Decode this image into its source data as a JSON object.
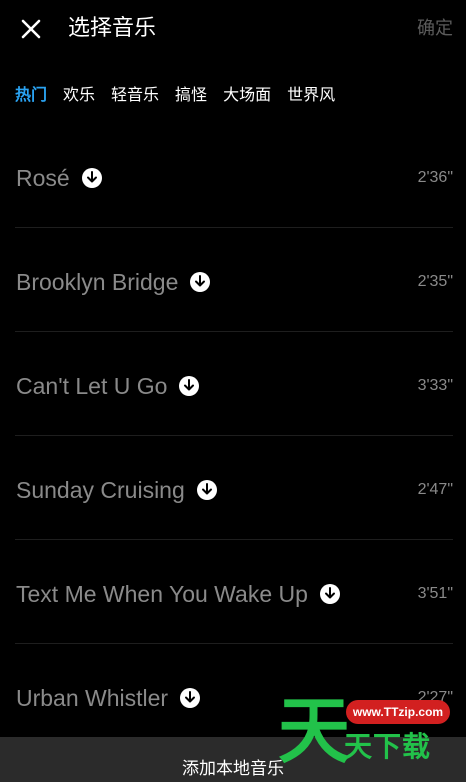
{
  "header": {
    "close_icon": "close-icon",
    "title": "选择音乐",
    "confirm_label": "确定"
  },
  "tabs": [
    {
      "label": "热门",
      "active": true
    },
    {
      "label": "欢乐",
      "active": false
    },
    {
      "label": "轻音乐",
      "active": false
    },
    {
      "label": "搞怪",
      "active": false
    },
    {
      "label": "大场面",
      "active": false
    },
    {
      "label": "世界风",
      "active": false
    }
  ],
  "songs": [
    {
      "title": "Rosé",
      "duration": "2'36\""
    },
    {
      "title": "Brooklyn Bridge",
      "duration": "2'35\""
    },
    {
      "title": "Can't Let U Go",
      "duration": "3'33\""
    },
    {
      "title": "Sunday Cruising",
      "duration": "2'47\""
    },
    {
      "title": "Text Me When You Wake Up",
      "duration": "3'51\""
    },
    {
      "title": "Urban Whistler",
      "duration": "2'27\""
    }
  ],
  "bottom_bar": {
    "label": "添加本地音乐"
  },
  "watermark": {
    "url": "www.TTzip.com",
    "big_char": "天",
    "text": "天下载"
  },
  "colors": {
    "accent": "#2aa3f2",
    "background": "#000000",
    "muted_text": "#8a8a8a",
    "bottom_bar": "#2b2b2b"
  }
}
